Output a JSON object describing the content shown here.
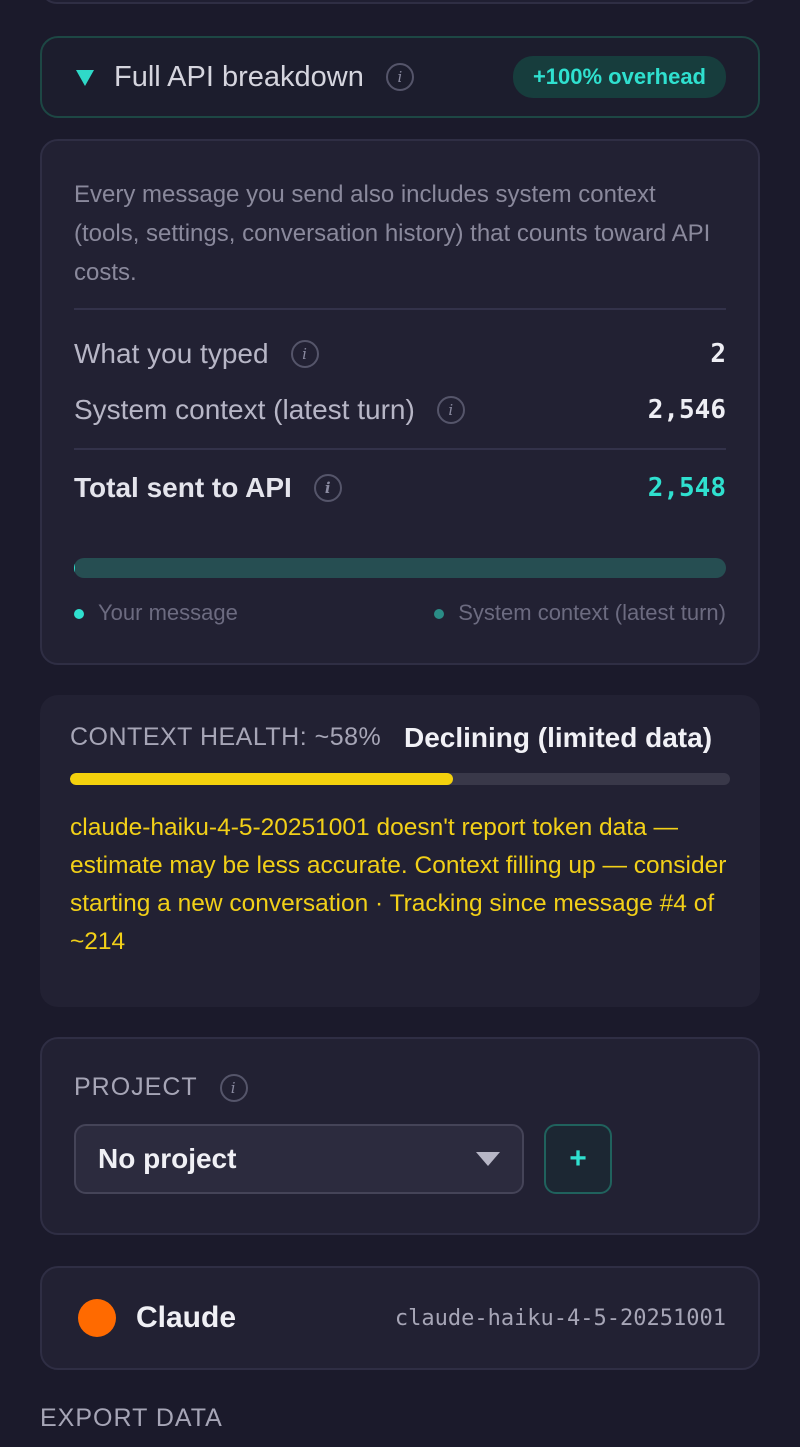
{
  "breakdown": {
    "title": "Full API breakdown",
    "overhead_badge": "+100% overhead",
    "description": "Every message you send also includes system context (tools, settings, conversation history) that counts toward API costs.",
    "rows": [
      {
        "label": "What you typed",
        "value": "2"
      },
      {
        "label": "System context (latest turn)",
        "value": "2,546"
      }
    ],
    "total": {
      "label": "Total sent to API",
      "value": "2,548"
    },
    "bar_message_fraction": 0.0008,
    "legend": {
      "message": "Your message",
      "system": "System context (latest turn)"
    }
  },
  "health": {
    "label": "CONTEXT HEALTH: ~58%",
    "status": "Declining (limited data)",
    "percent": 58,
    "note": "claude-haiku-4-5-20251001 doesn't report token data — estimate may be less accurate. Context filling up — consider starting a new conversation · Tracking since message #4 of ~214"
  },
  "project": {
    "label": "PROJECT",
    "selected": "No project",
    "add_label": "+"
  },
  "model": {
    "provider": "Claude",
    "id": "claude-haiku-4-5-20251001"
  },
  "export": {
    "label": "EXPORT DATA"
  },
  "colors": {
    "accent": "#2fd9c8",
    "warning": "#f4d10d",
    "provider_dot": "#ff6a00"
  }
}
